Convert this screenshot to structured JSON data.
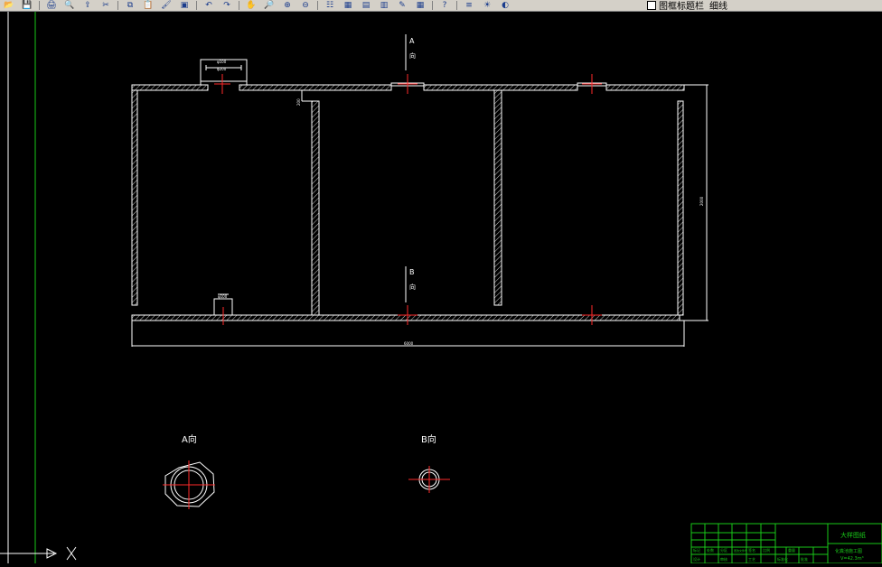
{
  "toolbar": {
    "icons": [
      "open-icon",
      "save-icon",
      "plot-icon",
      "preview-icon",
      "cut-icon",
      "copy-icon",
      "paste-icon",
      "match-icon",
      "undo-icon",
      "redo-icon",
      "pan-icon",
      "zoom-realtime-icon",
      "zoom-window-icon",
      "zoom-previous-icon",
      "properties-icon",
      "design-center-icon",
      "tool-palette-icon",
      "sheet-set-icon",
      "markup-icon",
      "calc-icon",
      "help-icon",
      "layer-manager-icon",
      "layer-state-icon"
    ],
    "layer_name": "图框标题栏",
    "linetype": "细线"
  },
  "drawing": {
    "label_a_top": "A",
    "label_a_top_dir": "向",
    "label_b_mid": "B",
    "label_b_mid_dir": "向",
    "view_a_title": "A向",
    "view_b_title": "B向",
    "dim_top_small": "φ100",
    "dim_top_inner": "φ200",
    "dim_bottom_small": "φ100",
    "dim_overall_width": "6000",
    "dim_height": "2000",
    "dim_gap": "200"
  },
  "titleblock": {
    "title": "大样图纸",
    "project": "化粪池施工图",
    "volume": "V=42.3m³",
    "row_labels": [
      "标记",
      "处数",
      "分区",
      "更改文件号",
      "签名",
      "年月日"
    ],
    "bottom_labels": [
      "设计",
      "审核",
      "工艺",
      "标准化",
      "批准"
    ],
    "scale_label": "比例",
    "weight_label": "重量"
  },
  "colors": {
    "background": "#000000",
    "lines": "#ffffff",
    "centerline": "#ff2a2a",
    "ucs": "#ffffff",
    "frame": "#19c819",
    "titleblock": "#19c819"
  }
}
